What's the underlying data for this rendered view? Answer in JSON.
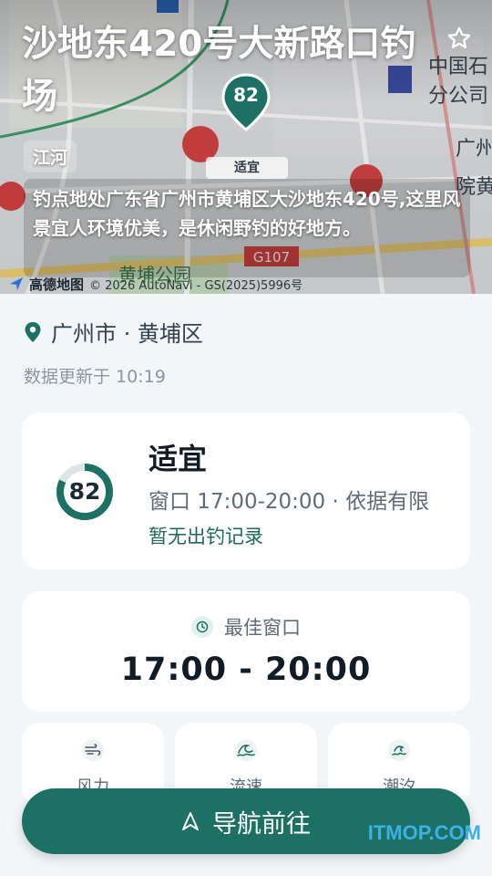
{
  "spot": {
    "title": "沙地东420号大新路口钓场",
    "score": "82",
    "map_label": "适宜",
    "region_chip": "江河",
    "description": "钓点地处广东省广州市黄埔区大沙地东420号,这里风景宜人环境优美，是休闲野钓的好地方。"
  },
  "map": {
    "attribution_logo": "高德地图",
    "attribution_text": "© 2026 AutoNavi - GS(2025)5996号"
  },
  "location": {
    "text": "广州市 · 黄埔区",
    "updated": "数据更新于 10:19"
  },
  "status_card": {
    "score": "82",
    "score_fraction": 0.82,
    "title": "适宜",
    "window": "窗口 17:00-20:00 · 依据有限",
    "record": "暂无出钓记录"
  },
  "best_window": {
    "label": "最佳窗口",
    "time": "17:00 - 20:00"
  },
  "mini_cards": [
    {
      "icon": "wind-icon",
      "label": "风力"
    },
    {
      "icon": "wave-icon",
      "label": "流速"
    },
    {
      "icon": "tide-icon",
      "label": "潮汐"
    }
  ],
  "navigate": {
    "label": "导航前往"
  },
  "watermark": "ITMOP.COM",
  "colors": {
    "accent": "#1d7164",
    "accent_text": "#1b6b5f",
    "ring_track": "#dce7e5"
  }
}
